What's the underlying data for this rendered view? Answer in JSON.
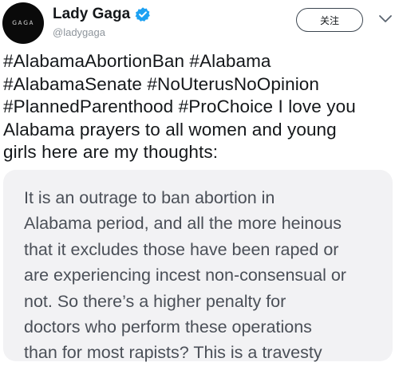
{
  "author": {
    "display_name": "Lady Gaga",
    "handle": "@ladygaga",
    "avatar_text": "ɢᴀɢᴀ",
    "verified_icon": "verified-badge-icon"
  },
  "actions": {
    "follow_label": "关注",
    "more_icon": "chevron-down-icon"
  },
  "tweet": {
    "lines": [
      "#AlabamaAbortionBan #Alabama",
      "#AlabamaSenate #NoUterusNoOpinion",
      "#PlannedParenthood #ProChoice I love you",
      "Alabama prayers to all women and young",
      "girls here are my thoughts:"
    ]
  },
  "statement": {
    "lines": [
      "It is an outrage to ban abortion in",
      "Alabama period, and all the more heinous",
      "that it excludes those have been raped or",
      "are experiencing incest non-consensual or",
      "not. So there’s a higher penalty for",
      "doctors who perform these operations",
      "than for most rapists? This is a travesty"
    ]
  },
  "colors": {
    "verified": "#1da1f2",
    "statement_background": "#f2f2f4"
  }
}
